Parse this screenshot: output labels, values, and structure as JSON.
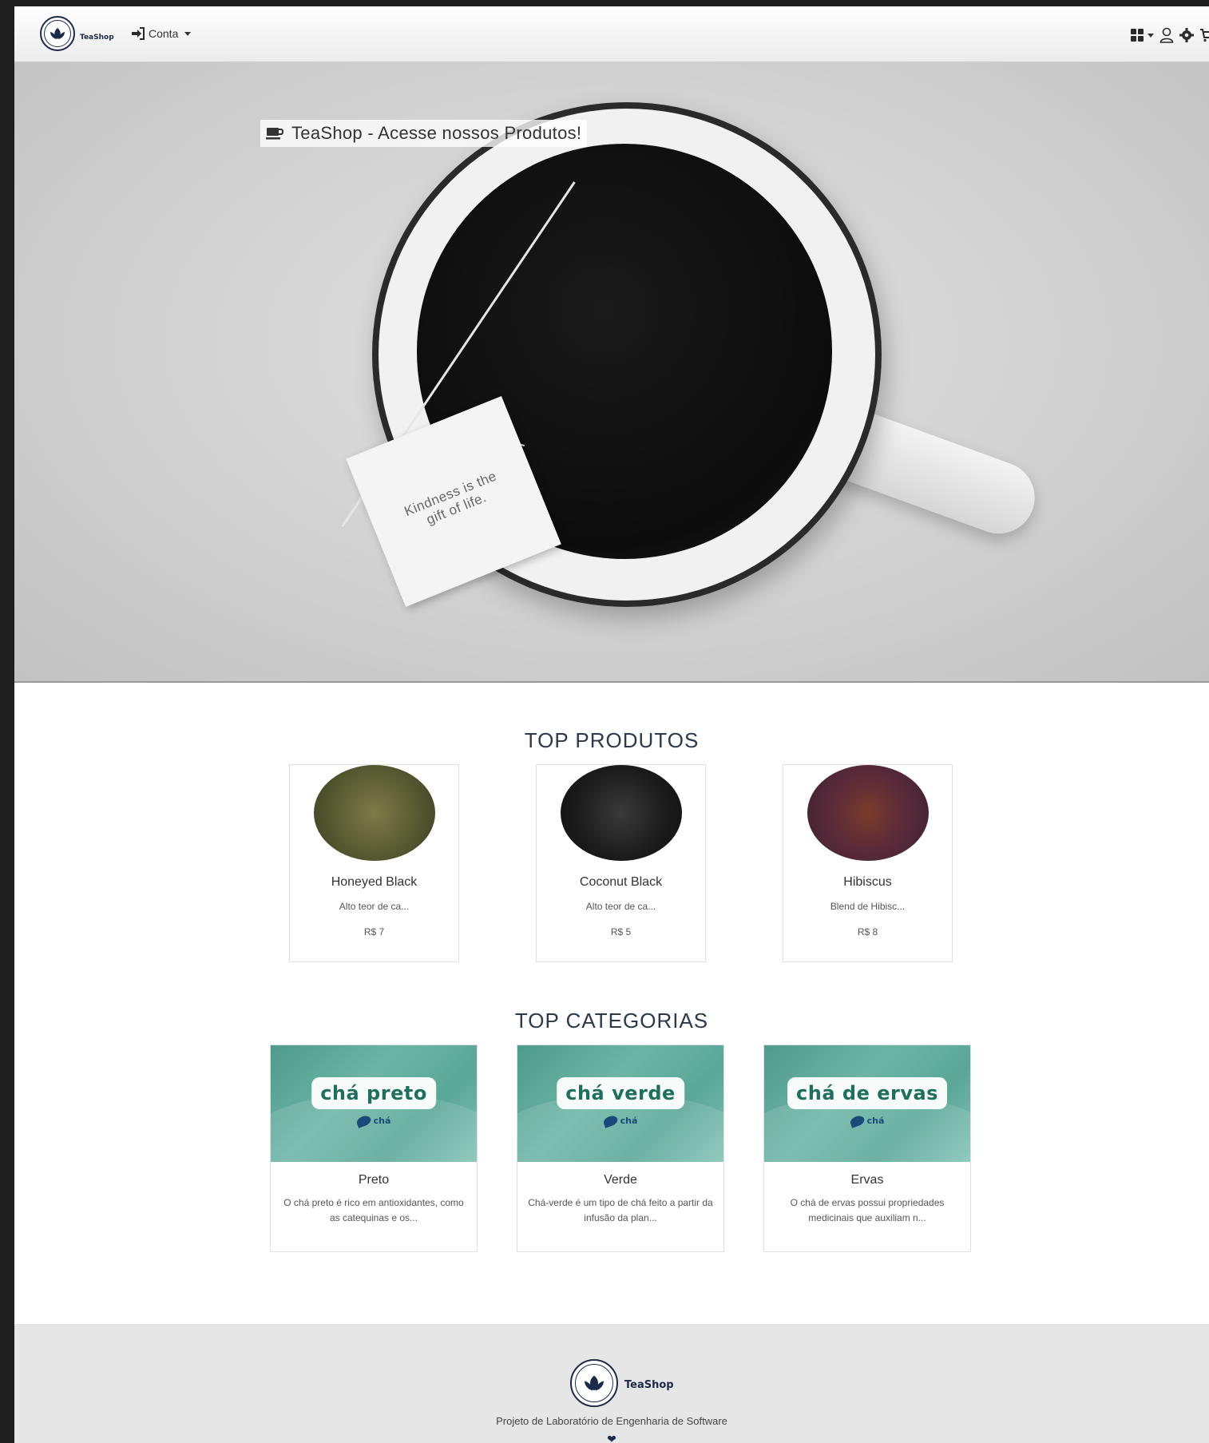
{
  "navbar": {
    "brand": "TeaShop",
    "account_label": "Conta",
    "icons": [
      "grid-icon",
      "user-icon",
      "gear-icon",
      "cart-icon"
    ]
  },
  "hero": {
    "banner_text": "TeaShop - Acesse nossos Produtos!",
    "tag_text": "Kindness is the gift of life."
  },
  "top_products": {
    "title": "TOP PRODUTOS",
    "items": [
      {
        "name": "Honeyed Black",
        "desc": "Alto teor de ca...",
        "price": "R$ 7"
      },
      {
        "name": "Coconut Black",
        "desc": "Alto teor de ca...",
        "price": "R$ 5"
      },
      {
        "name": "Hibiscus",
        "desc": "Blend de Hibisc...",
        "price": "R$ 8"
      }
    ]
  },
  "top_categories": {
    "title": "TOP CATEGORIAS",
    "items": [
      {
        "banner": "chá preto",
        "logo": "chá",
        "name": "Preto",
        "desc": "O chá preto é rico em antioxidantes, como as catequinas e os..."
      },
      {
        "banner": "chá verde",
        "logo": "chá",
        "name": "Verde",
        "desc": "Chá-verde é um tipo de chá feito a partir da infusão da plan..."
      },
      {
        "banner": "chá de ervas",
        "logo": "chá",
        "name": "Ervas",
        "desc": "O chá de ervas possui propriedades medicinais que auxiliam n..."
      }
    ]
  },
  "footer": {
    "brand": "TeaShop",
    "text": "Projeto de Laboratório de Engenharia de Software"
  },
  "colors": {
    "brand_navy": "#1b2a4a",
    "teal": "#5aa797",
    "footer_bg": "#e6e6e6"
  }
}
